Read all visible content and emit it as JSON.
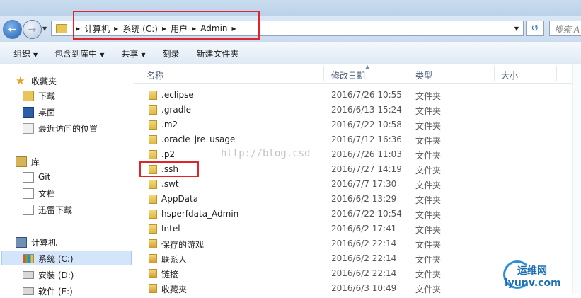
{
  "address": {
    "breadcrumbs": [
      "计算机",
      "系统 (C:)",
      "用户",
      "Admin"
    ],
    "search_placeholder": "搜索 A"
  },
  "toolbar": {
    "items": [
      {
        "label": "组织",
        "has_menu": true
      },
      {
        "label": "包含到库中",
        "has_menu": true
      },
      {
        "label": "共享",
        "has_menu": true
      },
      {
        "label": "刻录",
        "has_menu": false
      },
      {
        "label": "新建文件夹",
        "has_menu": false
      }
    ]
  },
  "nav": {
    "favorites": {
      "label": "收藏夹",
      "items": [
        "下载",
        "桌面",
        "最近访问的位置"
      ]
    },
    "libraries": {
      "label": "库",
      "items": [
        "Git",
        "文档",
        "迅雷下载"
      ]
    },
    "computer": {
      "label": "计算机",
      "items": [
        "系统 (C:)",
        "安装 (D:)",
        "软件 (E:)"
      ]
    }
  },
  "columns": {
    "name": "名称",
    "modified": "修改日期",
    "type": "类型",
    "size": "大小"
  },
  "files": [
    {
      "name": ".eclipse",
      "modified": "2016/7/26 10:55",
      "type": "文件夹"
    },
    {
      "name": ".gradle",
      "modified": "2016/6/13 15:24",
      "type": "文件夹"
    },
    {
      "name": ".m2",
      "modified": "2016/7/22 10:58",
      "type": "文件夹"
    },
    {
      "name": ".oracle_jre_usage",
      "modified": "2016/7/12 16:36",
      "type": "文件夹"
    },
    {
      "name": ".p2",
      "modified": "2016/7/26 11:03",
      "type": "文件夹"
    },
    {
      "name": ".ssh",
      "modified": "2016/7/27 14:19",
      "type": "文件夹"
    },
    {
      "name": ".swt",
      "modified": "2016/7/7 17:30",
      "type": "文件夹"
    },
    {
      "name": "AppData",
      "modified": "2016/6/2 13:29",
      "type": "文件夹"
    },
    {
      "name": "hsperfdata_Admin",
      "modified": "2016/7/22 10:54",
      "type": "文件夹"
    },
    {
      "name": "Intel",
      "modified": "2016/6/2 17:41",
      "type": "文件夹"
    },
    {
      "name": "保存的游戏",
      "modified": "2016/6/2 22:14",
      "type": "文件夹"
    },
    {
      "name": "联系人",
      "modified": "2016/6/2 22:14",
      "type": "文件夹"
    },
    {
      "name": "链接",
      "modified": "2016/6/2 22:14",
      "type": "文件夹"
    },
    {
      "name": "收藏夹",
      "modified": "2016/6/3 10:49",
      "type": "文件夹"
    }
  ],
  "watermark": "http://blog.csd",
  "logo": {
    "line1": "运维网",
    "line2": "iyunv.com"
  },
  "colors": {
    "highlight_box": "#e0252a",
    "selection": "#d3e5fa"
  }
}
